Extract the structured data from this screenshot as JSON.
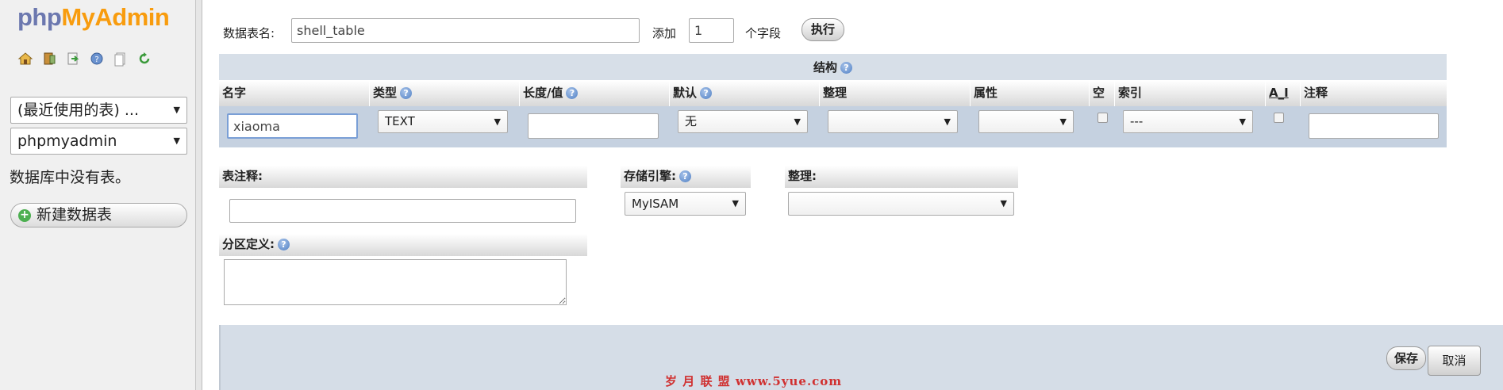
{
  "nav": {
    "logo_php": "php",
    "logo_myadmin": "MyAdmin",
    "icons": [
      "home-icon",
      "database-icon",
      "sql-query-icon",
      "help-icon",
      "docs-icon",
      "reload-icon"
    ],
    "recent_tables": "(最近使用的表) ...",
    "database_select": "phpmyadmin",
    "no_tables_text": "数据库中没有表。",
    "new_table_label": "新建数据表"
  },
  "form": {
    "table_name_label": "数据表名:",
    "table_name_value": "shell_table",
    "add_label": "添加",
    "add_count": "1",
    "fields_label": "个字段",
    "execute_label": "执行"
  },
  "structure": {
    "title": "结构",
    "columns": [
      "名字",
      "类型",
      "长度/值",
      "默认",
      "整理",
      "属性",
      "空",
      "索引",
      "A_I",
      "注释"
    ],
    "row": {
      "name": "xiaoma",
      "type": "TEXT",
      "length": "",
      "default": "无",
      "collation": "",
      "attribute": "",
      "index": "---",
      "comment": ""
    }
  },
  "table_options": {
    "table_comment_label": "表注释:",
    "storage_engine_label": "存储引擎:",
    "storage_engine_value": "MyISAM",
    "collation_label": "整理:",
    "collation_value": "",
    "partition_label": "分区定义:"
  },
  "footer": {
    "save_label": "保存",
    "cancel_label": "取消"
  },
  "watermark": "岁 月 联 盟  www.5yue.com",
  "colors": {
    "logo_php": "#6c78af",
    "logo_myadmin": "#f89c0e",
    "header_band": "#d7dfe8",
    "row_band": "#c5d1e0",
    "footer_band": "#d5dde7",
    "watermark": "#d03030"
  }
}
